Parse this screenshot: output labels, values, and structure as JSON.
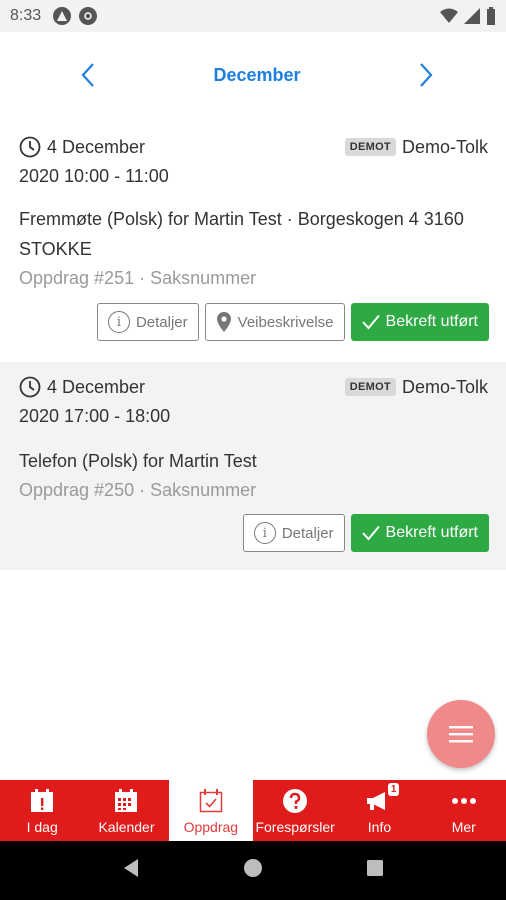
{
  "status": {
    "time": "8:33"
  },
  "header": {
    "month": "December"
  },
  "assignments": [
    {
      "date": "4 December",
      "time": "2020 10:00 - 11:00",
      "badge": "DEMOT",
      "tolk": "Demo-Tolk",
      "title": "Fremmøte (Polsk) for Martin Test · Borgeskogen 4 3160 STOKKE",
      "sub": "Oppdrag #251 · Saksnummer",
      "details_label": "Detaljer",
      "route_label": "Veibeskrivelse",
      "confirm_label": "Bekreft utført"
    },
    {
      "date": "4 December",
      "time": "2020 17:00 - 18:00",
      "badge": "DEMOT",
      "tolk": "Demo-Tolk",
      "title": "Telefon (Polsk) for Martin Test",
      "sub": "Oppdrag #250 · Saksnummer",
      "details_label": "Detaljer",
      "confirm_label": "Bekreft utført"
    }
  ],
  "tabs": [
    {
      "label": "I dag",
      "icon": "today-icon"
    },
    {
      "label": "Kalender",
      "icon": "calendar-icon"
    },
    {
      "label": "Oppdrag",
      "icon": "assignment-icon",
      "active": true
    },
    {
      "label": "Forespørsler",
      "icon": "question-icon"
    },
    {
      "label": "Info",
      "icon": "megaphone-icon",
      "badge": "1"
    },
    {
      "label": "Mer",
      "icon": "more-icon"
    }
  ],
  "colors": {
    "accent": "#1f7fe0",
    "brand_red": "#e01b1b",
    "confirm_green": "#2eaa45",
    "fab": "#f08a8a"
  }
}
